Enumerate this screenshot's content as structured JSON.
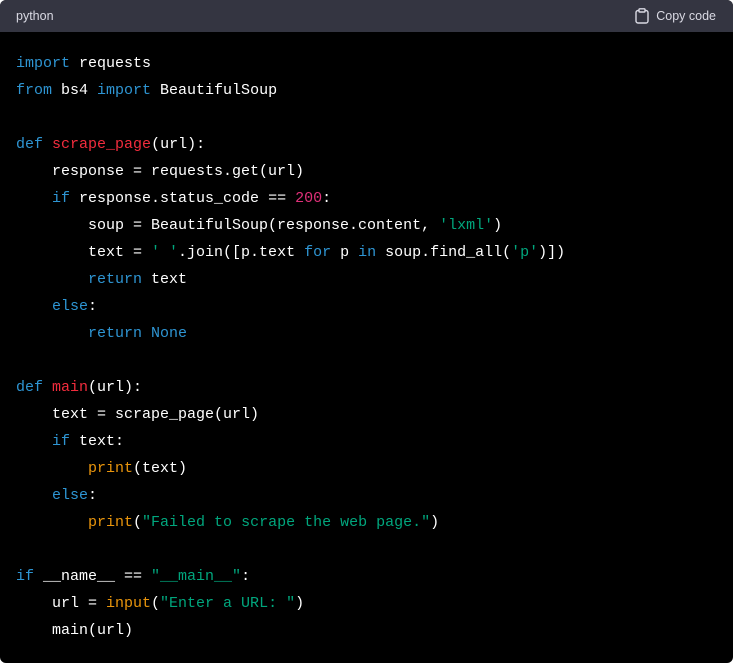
{
  "header": {
    "language": "python",
    "copy_label": "Copy code"
  },
  "colors": {
    "keyword": "#2e95d3",
    "function_name": "#f22c3d",
    "number": "#df3079",
    "string": "#00a67d",
    "builtin": "#e9950c",
    "plain": "#ffffff",
    "header_bg": "#343541",
    "code_bg": "#000000"
  },
  "icons": {
    "copy": "clipboard-icon"
  },
  "code_lines": [
    [
      [
        "kw",
        "import"
      ],
      [
        "pl",
        " requests"
      ]
    ],
    [
      [
        "kw",
        "from"
      ],
      [
        "pl",
        " bs4 "
      ],
      [
        "kw",
        "import"
      ],
      [
        "pl",
        " BeautifulSoup"
      ]
    ],
    [],
    [
      [
        "kw",
        "def"
      ],
      [
        "pl",
        " "
      ],
      [
        "fn",
        "scrape_page"
      ],
      [
        "pl",
        "(url):"
      ]
    ],
    [
      [
        "pl",
        "    response = requests.get(url)"
      ]
    ],
    [
      [
        "pl",
        "    "
      ],
      [
        "kw",
        "if"
      ],
      [
        "pl",
        " response.status_code == "
      ],
      [
        "num",
        "200"
      ],
      [
        "pl",
        ":"
      ]
    ],
    [
      [
        "pl",
        "        soup = BeautifulSoup(response.content, "
      ],
      [
        "str",
        "'lxml'"
      ],
      [
        "pl",
        ")"
      ]
    ],
    [
      [
        "pl",
        "        text = "
      ],
      [
        "str",
        "' '"
      ],
      [
        "pl",
        ".join([p.text "
      ],
      [
        "kw",
        "for"
      ],
      [
        "pl",
        " p "
      ],
      [
        "kw",
        "in"
      ],
      [
        "pl",
        " soup.find_all("
      ],
      [
        "str",
        "'p'"
      ],
      [
        "pl",
        ")])"
      ]
    ],
    [
      [
        "pl",
        "        "
      ],
      [
        "kw",
        "return"
      ],
      [
        "pl",
        " text"
      ]
    ],
    [
      [
        "pl",
        "    "
      ],
      [
        "kw",
        "else"
      ],
      [
        "pl",
        ":"
      ]
    ],
    [
      [
        "pl",
        "        "
      ],
      [
        "kw",
        "return"
      ],
      [
        "pl",
        " "
      ],
      [
        "kw",
        "None"
      ]
    ],
    [],
    [
      [
        "kw",
        "def"
      ],
      [
        "pl",
        " "
      ],
      [
        "fn",
        "main"
      ],
      [
        "pl",
        "(url):"
      ]
    ],
    [
      [
        "pl",
        "    text = scrape_page(url)"
      ]
    ],
    [
      [
        "pl",
        "    "
      ],
      [
        "kw",
        "if"
      ],
      [
        "pl",
        " text:"
      ]
    ],
    [
      [
        "pl",
        "        "
      ],
      [
        "bi",
        "print"
      ],
      [
        "pl",
        "(text)"
      ]
    ],
    [
      [
        "pl",
        "    "
      ],
      [
        "kw",
        "else"
      ],
      [
        "pl",
        ":"
      ]
    ],
    [
      [
        "pl",
        "        "
      ],
      [
        "bi",
        "print"
      ],
      [
        "pl",
        "("
      ],
      [
        "str",
        "\"Failed to scrape the web page.\""
      ],
      [
        "pl",
        ")"
      ]
    ],
    [],
    [
      [
        "kw",
        "if"
      ],
      [
        "pl",
        " __name__ == "
      ],
      [
        "str",
        "\"__main__\""
      ],
      [
        "pl",
        ":"
      ]
    ],
    [
      [
        "pl",
        "    url = "
      ],
      [
        "bi",
        "input"
      ],
      [
        "pl",
        "("
      ],
      [
        "str",
        "\"Enter a URL: \""
      ],
      [
        "pl",
        ")"
      ]
    ],
    [
      [
        "pl",
        "    main(url)"
      ]
    ]
  ]
}
